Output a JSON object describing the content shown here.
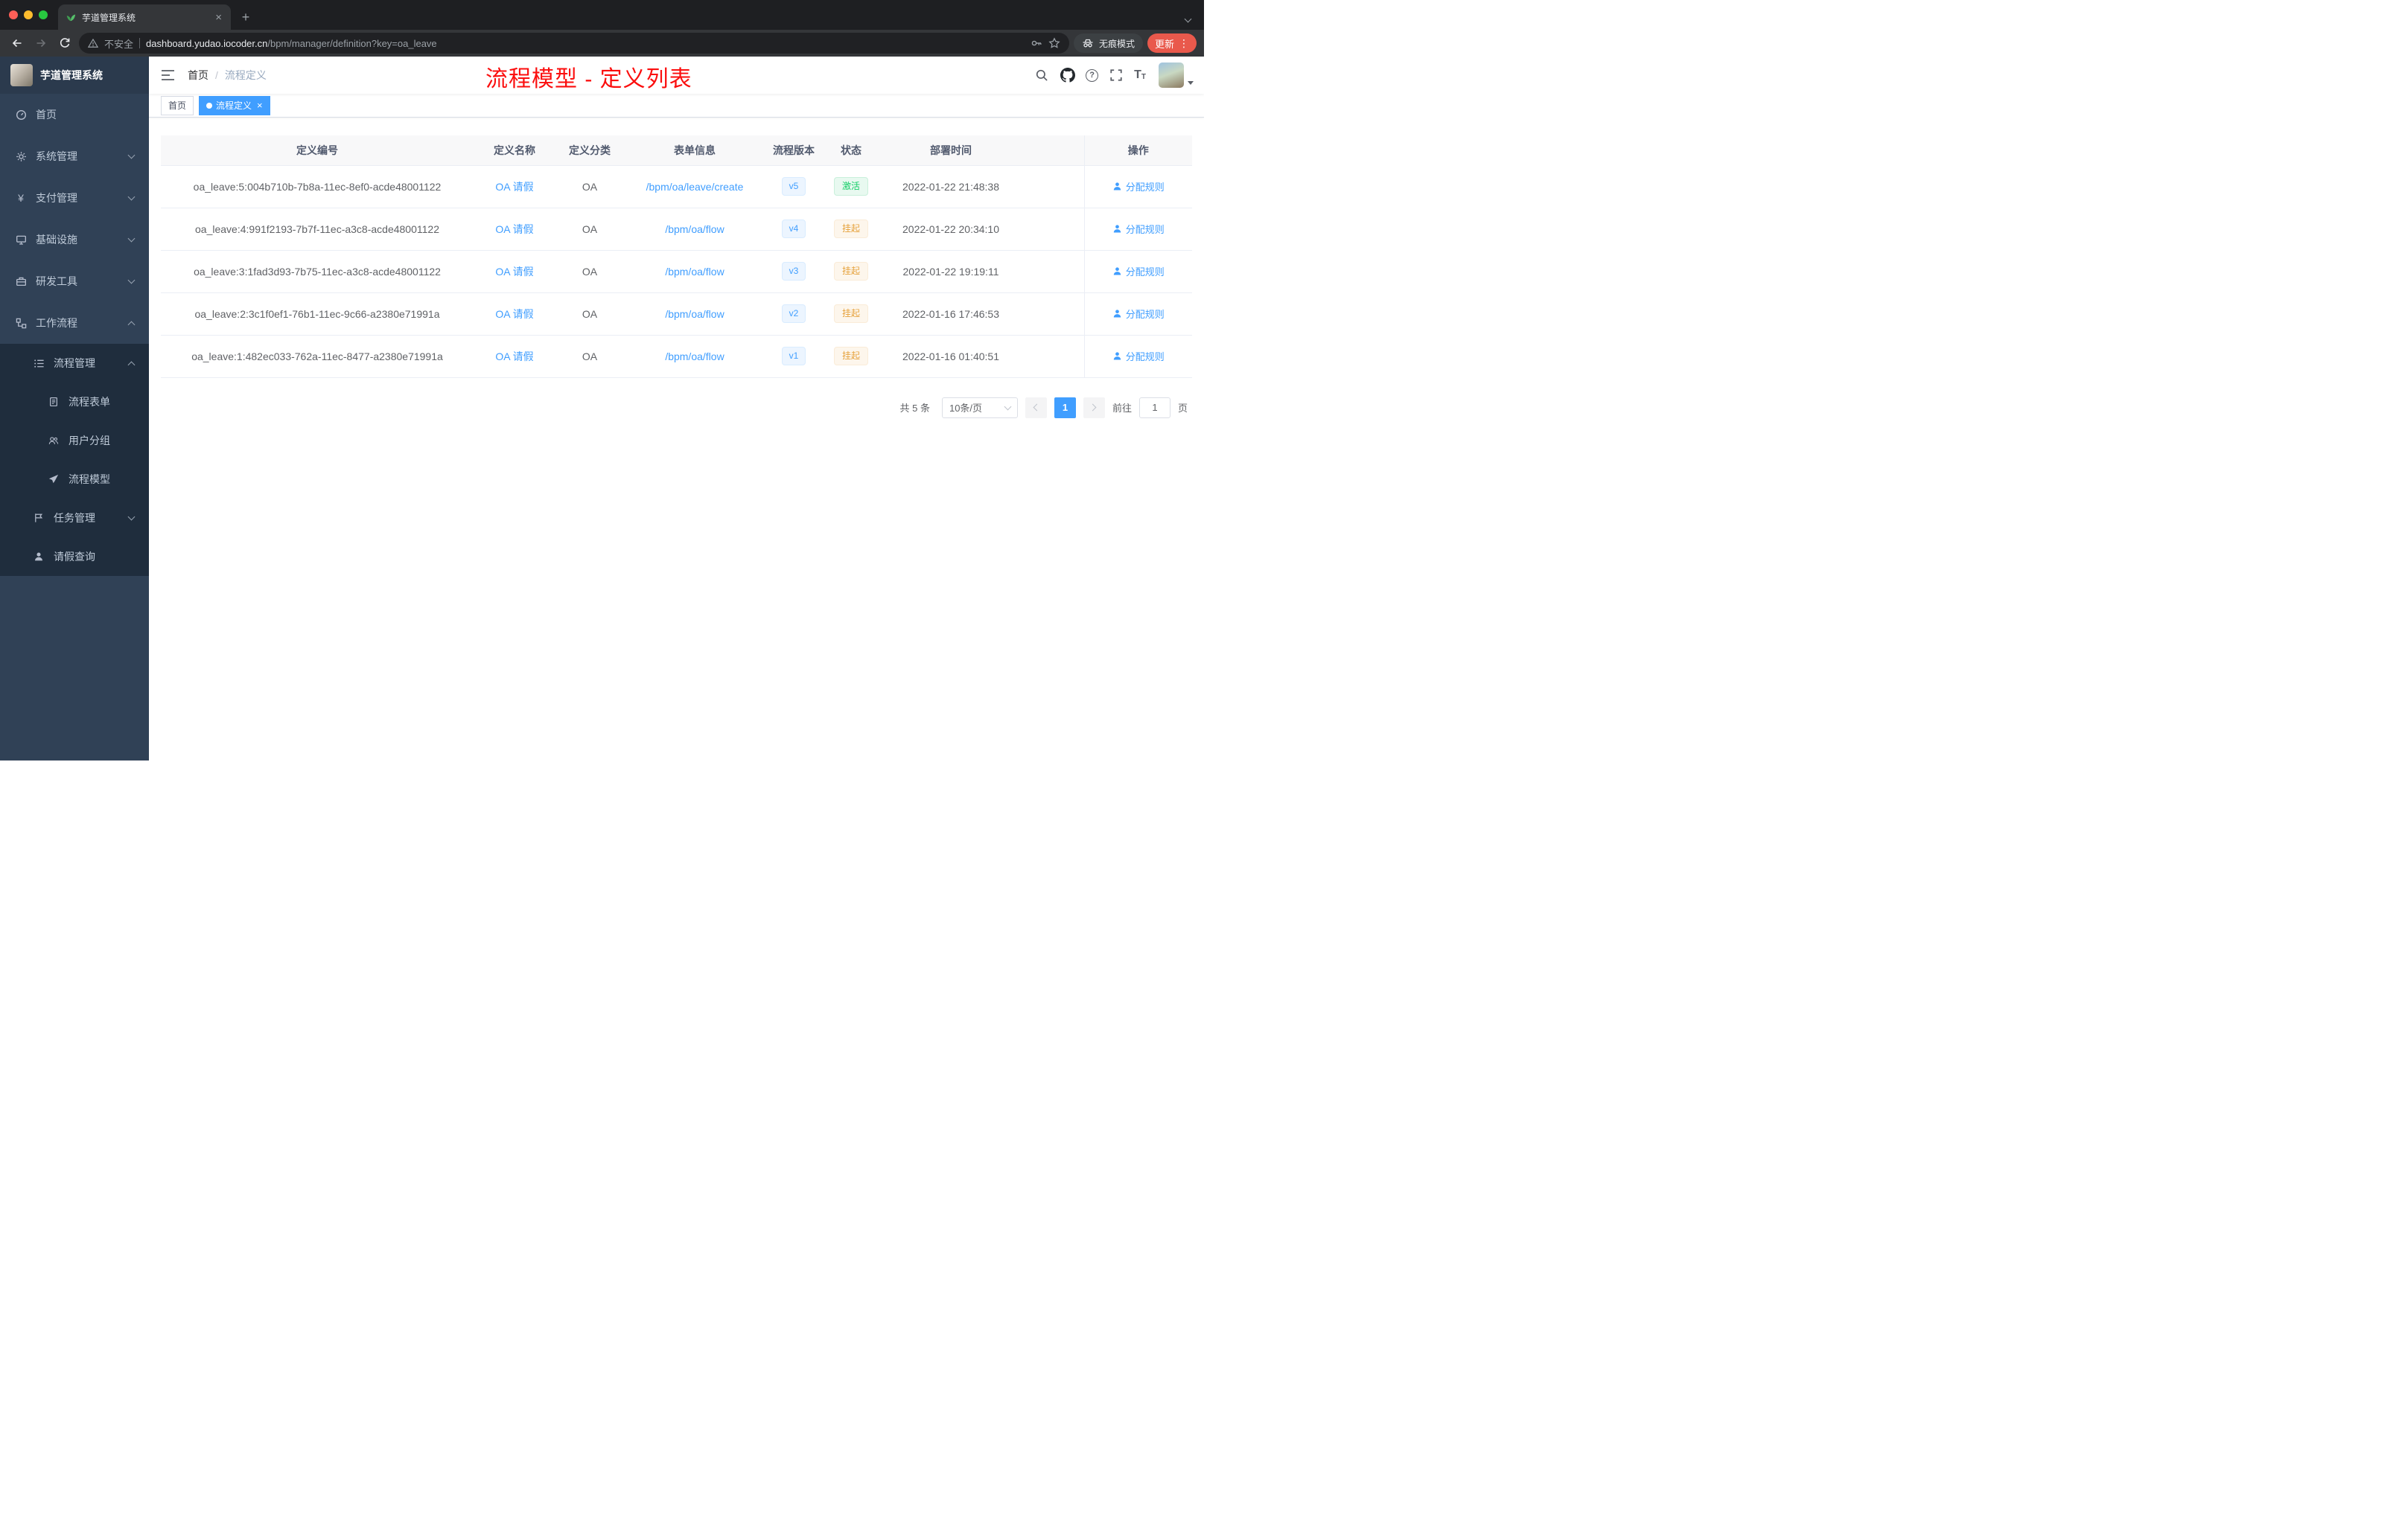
{
  "icons": {
    "close_glyph": "×",
    "plus_glyph": "+",
    "menu_dots_glyph": "⋮",
    "question_glyph": "?",
    "font_large_glyph": "T",
    "font_small_glyph": "T"
  },
  "browser": {
    "tab_title": "芋道管理系统",
    "security_label": "不安全",
    "url_host": "dashboard.yudao.iocoder.cn",
    "url_path": "/bpm/manager/definition?key=oa_leave",
    "incognito_label": "无痕模式",
    "update_label": "更新"
  },
  "sidebar": {
    "logo_title": "芋道管理系统",
    "items": [
      {
        "label": "首页"
      },
      {
        "label": "系统管理"
      },
      {
        "label": "支付管理"
      },
      {
        "label": "基础设施"
      },
      {
        "label": "研发工具"
      },
      {
        "label": "工作流程"
      },
      {
        "label": "流程管理"
      },
      {
        "label": "流程表单"
      },
      {
        "label": "用户分组"
      },
      {
        "label": "流程模型"
      },
      {
        "label": "任务管理"
      },
      {
        "label": "请假查询"
      }
    ]
  },
  "navbar": {
    "breadcrumb_home": "首页",
    "breadcrumb_separator": "/",
    "breadcrumb_current": "流程定义",
    "annotation": "流程模型 - 定义列表"
  },
  "tags": {
    "home_label": "首页",
    "active_label": "流程定义"
  },
  "table": {
    "columns": [
      "定义编号",
      "定义名称",
      "定义分类",
      "表单信息",
      "流程版本",
      "状态",
      "部署时间",
      "操作"
    ],
    "rows": [
      {
        "id": "oa_leave:5:004b710b-7b8a-11ec-8ef0-acde48001122",
        "name": "OA 请假",
        "category": "OA",
        "form": "/bpm/oa/leave/create",
        "version": "v5",
        "status": "激活",
        "deploy_time": "2022-01-22 21:48:38",
        "action": "分配规则"
      },
      {
        "id": "oa_leave:4:991f2193-7b7f-11ec-a3c8-acde48001122",
        "name": "OA 请假",
        "category": "OA",
        "form": "/bpm/oa/flow",
        "version": "v4",
        "status": "挂起",
        "deploy_time": "2022-01-22 20:34:10",
        "action": "分配规则"
      },
      {
        "id": "oa_leave:3:1fad3d93-7b75-11ec-a3c8-acde48001122",
        "name": "OA 请假",
        "category": "OA",
        "form": "/bpm/oa/flow",
        "version": "v3",
        "status": "挂起",
        "deploy_time": "2022-01-22 19:19:11",
        "action": "分配规则"
      },
      {
        "id": "oa_leave:2:3c1f0ef1-76b1-11ec-9c66-a2380e71991a",
        "name": "OA 请假",
        "category": "OA",
        "form": "/bpm/oa/flow",
        "version": "v2",
        "status": "挂起",
        "deploy_time": "2022-01-16 17:46:53",
        "action": "分配规则"
      },
      {
        "id": "oa_leave:1:482ec033-762a-11ec-8477-a2380e71991a",
        "name": "OA 请假",
        "category": "OA",
        "form": "/bpm/oa/flow",
        "version": "v1",
        "status": "挂起",
        "deploy_time": "2022-01-16 01:40:51",
        "action": "分配规则"
      }
    ]
  },
  "pagination": {
    "total_label": "共 5 条",
    "page_size_label": "10条/页",
    "current_page": "1",
    "goto_label": "前往",
    "goto_value": "1",
    "page_unit_label": "页"
  }
}
